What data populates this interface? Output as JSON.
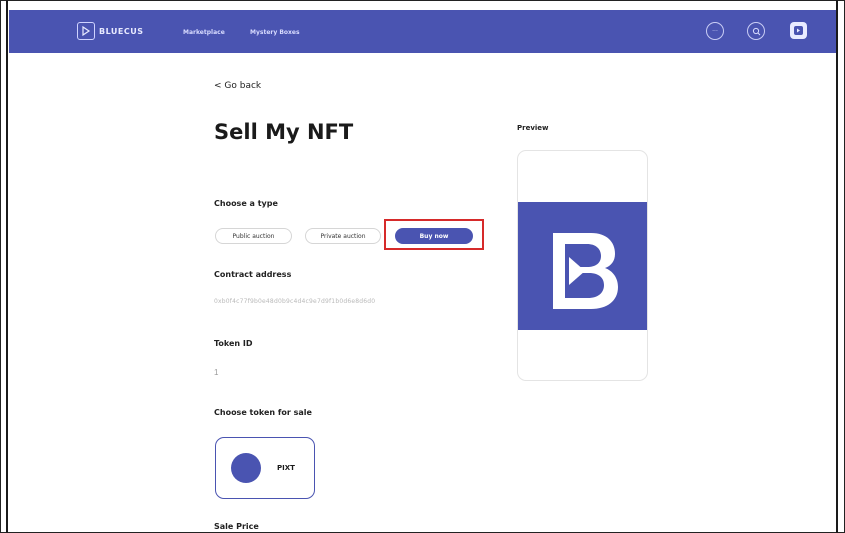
{
  "navbar": {
    "brand": "BLUECUS",
    "links": [
      "Marketplace",
      "Mystery Boxes"
    ],
    "icon_more": "more-icon",
    "icon_search": "search-icon",
    "accent": "#4a54b1"
  },
  "page": {
    "back_label": "< Go back",
    "title": "Sell My NFT",
    "type_label": "Choose a type",
    "types": [
      "Public auction",
      "Private auction",
      "Buy now"
    ],
    "selected_type": "Buy now",
    "contract_label": "Contract address",
    "contract_value": "0xb0f4c77f9b0e48d0b9c4d4c9e7d9f1b0d6e8d6d0",
    "tokenid_label": "Token ID",
    "tokenid_value": "1",
    "token_sale_label": "Choose token for sale",
    "token_name": "PIXT",
    "sale_price_label": "Sale Price"
  },
  "preview": {
    "label": "Preview",
    "image_icon": "bluecus-logo-icon"
  },
  "annotation": {
    "highlight_color": "#d62a2a"
  }
}
